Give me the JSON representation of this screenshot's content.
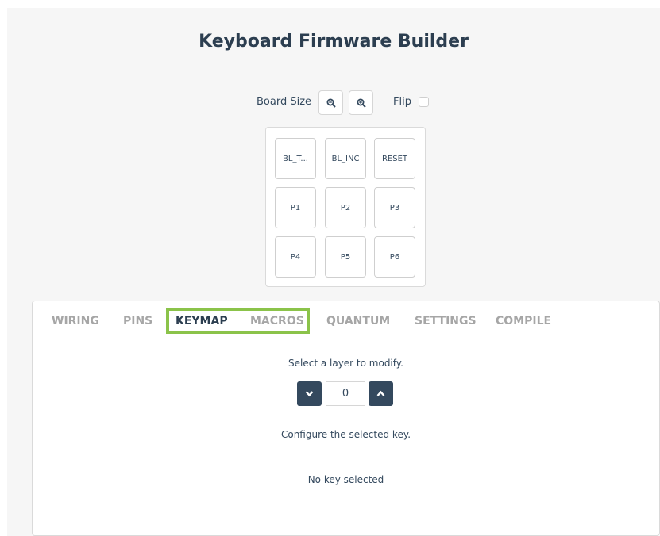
{
  "app": {
    "title": "Keyboard Firmware Builder"
  },
  "toolbar": {
    "board_size_label": "Board Size",
    "zoom_out_icon": "zoom-out-icon",
    "zoom_in_icon": "zoom-in-icon",
    "flip_label": "Flip",
    "flip_checked": false
  },
  "board": {
    "keys": [
      {
        "label": "BL_T..."
      },
      {
        "label": "BL_INC"
      },
      {
        "label": "RESET"
      },
      {
        "label": "P1"
      },
      {
        "label": "P2"
      },
      {
        "label": "P3"
      },
      {
        "label": "P4"
      },
      {
        "label": "P5"
      },
      {
        "label": "P6"
      }
    ]
  },
  "tabs": [
    {
      "label": "WIRING",
      "active": false
    },
    {
      "label": "PINS",
      "active": false
    },
    {
      "label": "KEYMAP",
      "active": true
    },
    {
      "label": "MACROS",
      "active": false
    },
    {
      "label": "QUANTUM",
      "active": false
    },
    {
      "label": "SETTINGS",
      "active": false
    },
    {
      "label": "COMPILE",
      "active": false
    }
  ],
  "keymap": {
    "select_layer_text": "Select a layer to modify.",
    "layer_value": "0",
    "configure_text": "Configure the selected key.",
    "no_key_text": "No key selected"
  },
  "colors": {
    "accent_highlight": "#8bc34a",
    "button_dark": "#34495e",
    "tab_inactive": "#a6a6a6",
    "tab_active": "#2c3e50"
  }
}
